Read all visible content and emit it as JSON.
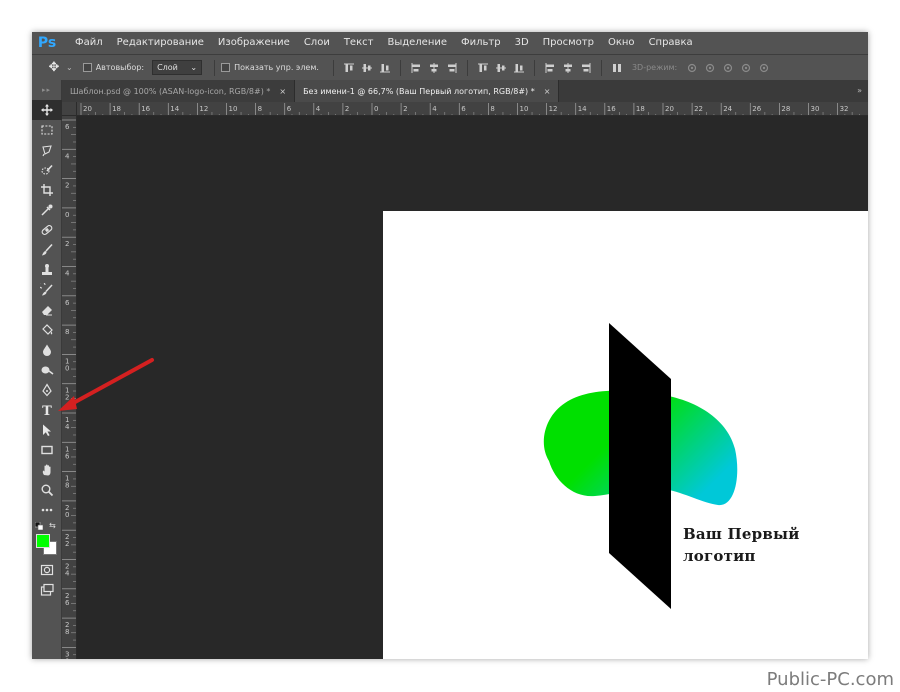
{
  "app": {
    "logo": "Ps",
    "menu": [
      "Файл",
      "Редактирование",
      "Изображение",
      "Слои",
      "Текст",
      "Выделение",
      "Фильтр",
      "3D",
      "Просмотр",
      "Окно",
      "Справка"
    ]
  },
  "options": {
    "autoselect_label": "Автовыбор:",
    "autoselect_value": "Слой",
    "show_transform_label": "Показать упр. элем.",
    "mode3d_label": "3D-режим:"
  },
  "tabs": [
    {
      "label": "Шаблон.psd @ 100% (ASAN-logo-icon, RGB/8#) *",
      "active": false,
      "close": "×"
    },
    {
      "label": "Без имени-1 @ 66,7% (Ваш Первый логотип, RGB/8#) *",
      "active": true,
      "close": "×"
    }
  ],
  "tab_overflow": "»",
  "ruler_h_labels": [
    "20",
    "18",
    "16",
    "14",
    "12",
    "10",
    "8",
    "6",
    "4",
    "2",
    "0",
    "2",
    "4",
    "6",
    "8",
    "10",
    "12",
    "14",
    "16",
    "18",
    "20",
    "22",
    "24",
    "26",
    "28",
    "30",
    "32"
  ],
  "ruler_v_labels": [
    "6",
    "4",
    "2",
    "0",
    "2",
    "4",
    "6",
    "8",
    "1\n0",
    "1\n2",
    "1\n4",
    "1\n6",
    "1\n8",
    "2\n0",
    "2\n2",
    "2\n4",
    "2\n6",
    "2\n8",
    "3\n0"
  ],
  "canvas": {
    "logo_text_line1": "Ваш Первый",
    "logo_text_line2": "логотип",
    "gradient_start": "#00e000",
    "gradient_end": "#00c8d8",
    "bar_color": "#000000"
  },
  "swatches": {
    "foreground": "#00ff00",
    "background": "#ffffff"
  },
  "annotation": {
    "arrow_color": "#d42020",
    "points_to": "type-tool"
  },
  "watermark": "Public-PC.com"
}
